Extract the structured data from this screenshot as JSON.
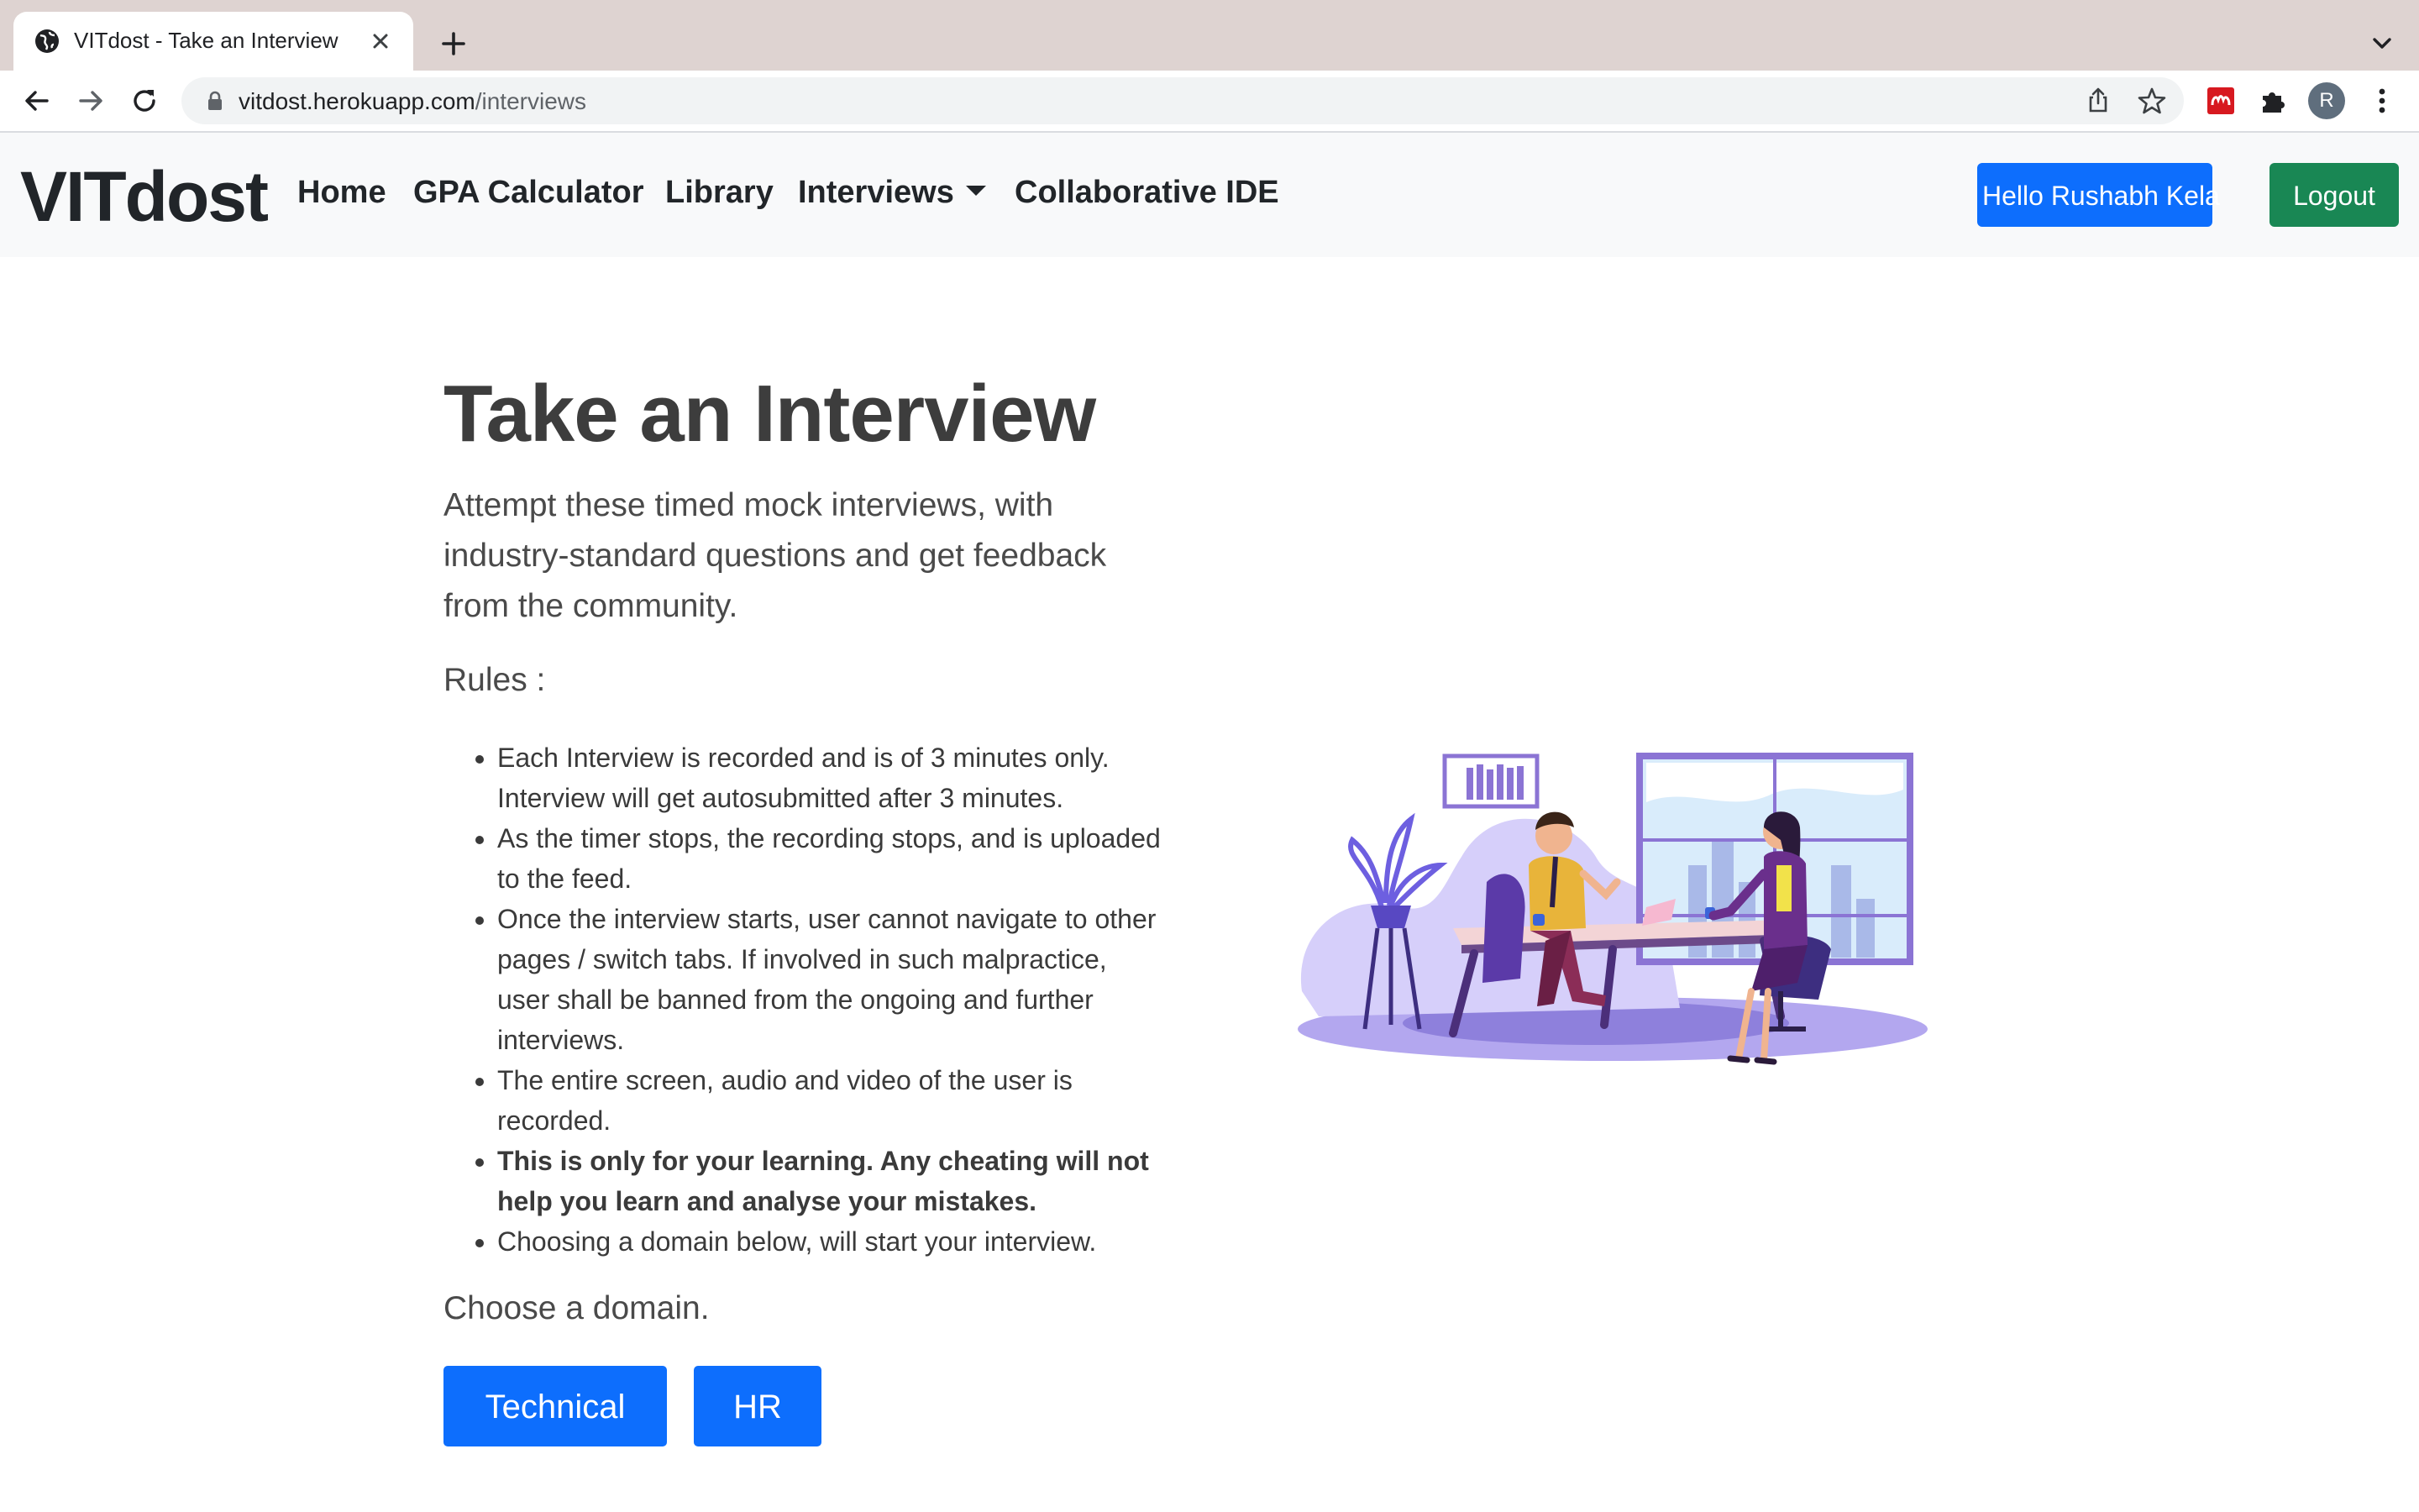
{
  "browser": {
    "tab_title": "VITdost - Take an Interview",
    "url_host": "vitdost.herokuapp.com",
    "url_path": "/interviews",
    "profile_initial": "R",
    "icons": [
      "globe-icon",
      "close-icon",
      "plus-icon",
      "chevron-down-icon",
      "back-arrow-icon",
      "forward-arrow-icon",
      "reload-icon",
      "lock-icon",
      "share-icon",
      "star-icon",
      "mendeley-extension-icon",
      "puzzle-icon",
      "kebab-menu-icon"
    ]
  },
  "navbar": {
    "brand": "VITdost",
    "links": [
      "Home",
      "GPA Calculator",
      "Library",
      "Interviews",
      "Collaborative IDE"
    ],
    "greeting_button": "Hello Rushabh Kela",
    "logout_button": "Logout"
  },
  "main": {
    "title": "Take an Interview",
    "lead": "Attempt these timed mock interviews, with industry-standard questions and get feedback from the community.",
    "rules_heading": "Rules :",
    "rules": [
      "Each Interview is recorded and is of 3 minutes only. Interview will get autosubmitted after 3 minutes.",
      "As the timer stops, the recording stops, and is uploaded to the feed.",
      "Once the interview starts, user cannot navigate to other pages / switch tabs. If involved in such malpractice, user shall be banned from the ongoing and further interviews.",
      "The entire screen, audio and video of the user is recorded.",
      "This is only for your learning. Any cheating will not help you learn and analyse your mistakes.",
      "Choosing a domain below, will start your interview."
    ],
    "choose_label": "Choose a domain.",
    "domain_buttons": [
      "Technical",
      "HR"
    ]
  },
  "colors": {
    "primary": "#0d6efd",
    "success": "#198754",
    "illustration_purple": "#6c5ce7"
  }
}
